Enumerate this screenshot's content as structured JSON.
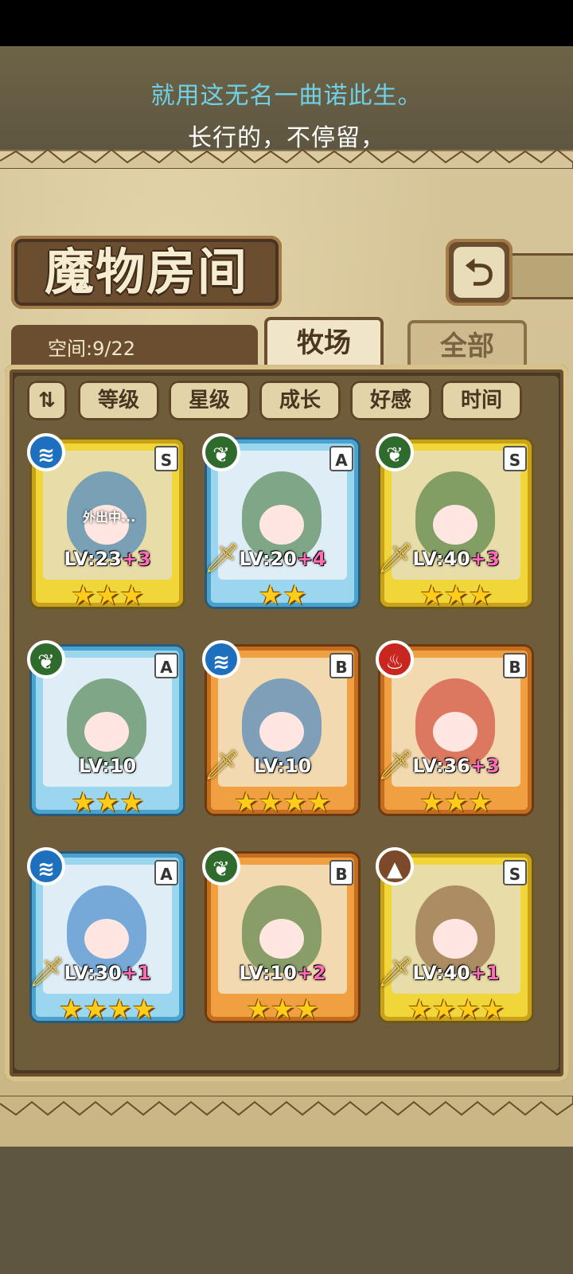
{
  "subtitles": {
    "line1": "就用这无名一曲诺此生。",
    "line2": "长行的，不停留，"
  },
  "header": {
    "title": "魔物房间",
    "back_icon": "return-arrow-icon"
  },
  "room": {
    "space_label": "空间:9/22"
  },
  "tabs": [
    {
      "label": "牧场",
      "active": true
    },
    {
      "label": "全部",
      "active": false
    }
  ],
  "filters": {
    "sort_icon": "sort-toggle-icon",
    "buttons": [
      "等级",
      "星级",
      "成长",
      "好感",
      "时间"
    ]
  },
  "monsters": [
    {
      "element": "water",
      "element_icon": "water-wave-icon",
      "rank": "S",
      "level": "LV:23",
      "bonus": "+3",
      "stars": 3,
      "status": "外出中...",
      "weapon": false
    },
    {
      "element": "wood",
      "element_icon": "leaf-icon",
      "rank": "A",
      "level": "LV:20",
      "bonus": "+4",
      "stars": 2,
      "status": "",
      "weapon": true
    },
    {
      "element": "wood",
      "element_icon": "leaf-icon",
      "rank": "S",
      "level": "LV:40",
      "bonus": "+3",
      "stars": 3,
      "status": "",
      "weapon": true
    },
    {
      "element": "wood",
      "element_icon": "leaf-icon",
      "rank": "A",
      "level": "LV:10",
      "bonus": "",
      "stars": 3,
      "status": "",
      "weapon": false
    },
    {
      "element": "water",
      "element_icon": "water-wave-icon",
      "rank": "B",
      "level": "LV:10",
      "bonus": "",
      "stars": 4,
      "status": "",
      "weapon": true
    },
    {
      "element": "fire",
      "element_icon": "flame-icon",
      "rank": "B",
      "level": "LV:36",
      "bonus": "+3",
      "stars": 3,
      "status": "",
      "weapon": true
    },
    {
      "element": "water",
      "element_icon": "water-wave-icon",
      "rank": "A",
      "level": "LV:30",
      "bonus": "+1",
      "stars": 4,
      "status": "",
      "weapon": true
    },
    {
      "element": "wood",
      "element_icon": "leaf-icon",
      "rank": "B",
      "level": "LV:10",
      "bonus": "+2",
      "stars": 3,
      "status": "",
      "weapon": false
    },
    {
      "element": "earth",
      "element_icon": "mountain-icon",
      "rank": "S",
      "level": "LV:40",
      "bonus": "+1",
      "stars": 4,
      "status": "",
      "weapon": true
    }
  ],
  "colors": {
    "water": "#1f6fbf",
    "wood": "#2f6b2c",
    "fire": "#c8261f",
    "earth": "#7a4a2a",
    "star": "#ffcc1a"
  }
}
